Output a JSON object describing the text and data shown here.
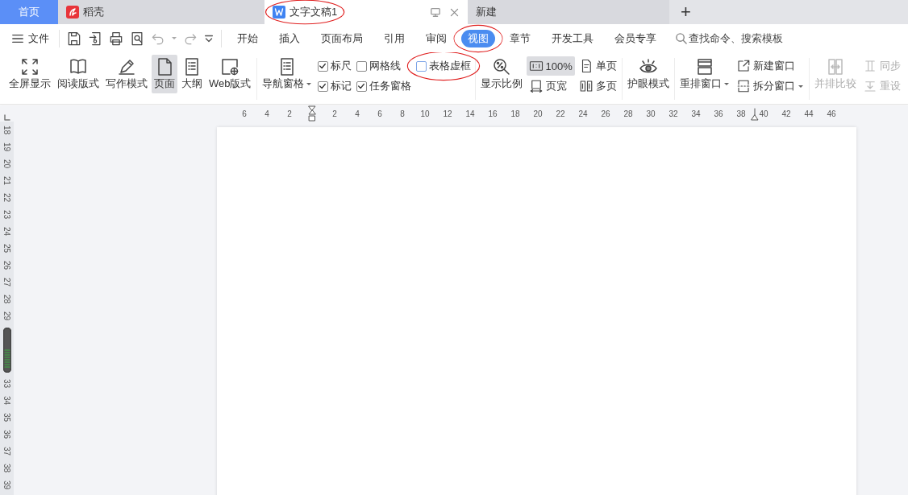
{
  "tabs": [
    {
      "kind": "home",
      "label": "首页",
      "selected": false,
      "circled": false
    },
    {
      "kind": "docer",
      "label": "稻壳",
      "selected": false,
      "circled": false
    },
    {
      "kind": "document",
      "label": "文字文稿1",
      "selected": true,
      "circled": true
    },
    {
      "kind": "new",
      "label": "新建",
      "selected": false,
      "circled": false
    }
  ],
  "new_tab_button": "+",
  "menu": {
    "file_label": "文件",
    "items": [
      {
        "label": "开始",
        "selected": false,
        "circled": false
      },
      {
        "label": "插入",
        "selected": false,
        "circled": false
      },
      {
        "label": "页面布局",
        "selected": false,
        "circled": false
      },
      {
        "label": "引用",
        "selected": false,
        "circled": false
      },
      {
        "label": "审阅",
        "selected": false,
        "circled": false
      },
      {
        "label": "视图",
        "selected": true,
        "circled": true
      },
      {
        "label": "章节",
        "selected": false,
        "circled": false
      },
      {
        "label": "开发工具",
        "selected": false,
        "circled": false
      },
      {
        "label": "会员专享",
        "selected": false,
        "circled": false
      }
    ],
    "search_placeholder": "查找命令、搜索模板"
  },
  "ribbon": {
    "groups": [
      {
        "columns": [
          {
            "kind": "large",
            "label": "全屏显示",
            "selected": false,
            "disabled": false,
            "has_menu": false
          },
          {
            "kind": "large",
            "label": "阅读版式",
            "selected": false,
            "disabled": false,
            "has_menu": false
          },
          {
            "kind": "large",
            "label": "写作模式",
            "selected": false,
            "disabled": false,
            "has_menu": false
          },
          {
            "kind": "large",
            "label": "页面",
            "selected": true,
            "disabled": false,
            "has_menu": false
          },
          {
            "kind": "large",
            "label": "大纲",
            "selected": false,
            "disabled": false,
            "has_menu": false
          },
          {
            "kind": "large",
            "label": "Web版式",
            "selected": false,
            "disabled": false,
            "has_menu": false
          }
        ]
      },
      {
        "columns": [
          {
            "kind": "large",
            "label": "导航窗格",
            "selected": false,
            "disabled": false,
            "has_menu": true
          },
          {
            "kind": "stack",
            "items": [
              {
                "kind": "check",
                "label": "标尺",
                "checked": true,
                "circled": false
              },
              {
                "kind": "check",
                "label": "标记",
                "checked": true,
                "circled": false
              }
            ]
          },
          {
            "kind": "stack",
            "items": [
              {
                "kind": "check",
                "label": "网格线",
                "checked": false,
                "circled": false
              },
              {
                "kind": "check",
                "label": "任务窗格",
                "checked": true,
                "circled": false
              }
            ]
          },
          {
            "kind": "stack",
            "items": [
              {
                "kind": "check",
                "label": "表格虚框",
                "checked": false,
                "circled": true
              }
            ]
          }
        ]
      },
      {
        "columns": [
          {
            "kind": "large",
            "label": "显示比例",
            "selected": false,
            "disabled": false,
            "has_menu": false
          },
          {
            "kind": "stack",
            "items": [
              {
                "kind": "button",
                "label": "100%",
                "selected": true,
                "disabled": false,
                "has_menu": false
              },
              {
                "kind": "button",
                "label": "页宽",
                "selected": false,
                "disabled": false,
                "has_menu": false
              }
            ]
          },
          {
            "kind": "stack",
            "items": [
              {
                "kind": "button",
                "label": "单页",
                "selected": false,
                "disabled": false,
                "has_menu": false
              },
              {
                "kind": "button",
                "label": "多页",
                "selected": false,
                "disabled": false,
                "has_menu": false
              }
            ]
          }
        ]
      },
      {
        "columns": [
          {
            "kind": "large",
            "label": "护眼模式",
            "selected": false,
            "disabled": false,
            "has_menu": false
          }
        ]
      },
      {
        "columns": [
          {
            "kind": "large",
            "label": "重排窗口",
            "selected": false,
            "disabled": false,
            "has_menu": true
          },
          {
            "kind": "stack",
            "items": [
              {
                "kind": "button",
                "label": "新建窗口",
                "selected": false,
                "disabled": false,
                "has_menu": false
              },
              {
                "kind": "button",
                "label": "拆分窗口",
                "selected": false,
                "disabled": false,
                "has_menu": true
              }
            ]
          }
        ]
      },
      {
        "columns": [
          {
            "kind": "large",
            "label": "并排比较",
            "selected": false,
            "disabled": true,
            "has_menu": false
          },
          {
            "kind": "stack",
            "items": [
              {
                "kind": "button",
                "label": "同步",
                "selected": false,
                "disabled": true,
                "has_menu": false
              },
              {
                "kind": "button",
                "label": "重设",
                "selected": false,
                "disabled": true,
                "has_menu": false
              }
            ]
          }
        ]
      }
    ]
  },
  "ruler": {
    "top": [
      {
        "kind": "number",
        "label": "6"
      },
      {
        "kind": "number",
        "label": "4"
      },
      {
        "kind": "number",
        "label": "2"
      },
      {
        "kind": "indent"
      },
      {
        "kind": "number",
        "label": "2"
      },
      {
        "kind": "number",
        "label": "4"
      },
      {
        "kind": "number",
        "label": "6"
      },
      {
        "kind": "number",
        "label": "8"
      },
      {
        "kind": "number",
        "label": "10"
      },
      {
        "kind": "number",
        "label": "12"
      },
      {
        "kind": "number",
        "label": "14"
      },
      {
        "kind": "number",
        "label": "16"
      },
      {
        "kind": "number",
        "label": "18"
      },
      {
        "kind": "number",
        "label": "20"
      },
      {
        "kind": "number",
        "label": "22"
      },
      {
        "kind": "number",
        "label": "24"
      },
      {
        "kind": "number",
        "label": "26"
      },
      {
        "kind": "number",
        "label": "28"
      },
      {
        "kind": "number",
        "label": "30"
      },
      {
        "kind": "number",
        "label": "32"
      },
      {
        "kind": "number",
        "label": "34"
      },
      {
        "kind": "number",
        "label": "36"
      },
      {
        "kind": "number",
        "label": "38"
      },
      {
        "kind": "right_indent"
      },
      {
        "kind": "number",
        "label": "40"
      },
      {
        "kind": "number",
        "label": "42"
      },
      {
        "kind": "number",
        "label": "44"
      },
      {
        "kind": "number",
        "label": "46"
      }
    ],
    "side": [
      {
        "kind": "number",
        "label": "18"
      },
      {
        "kind": "number",
        "label": "19"
      },
      {
        "kind": "number",
        "label": "20"
      },
      {
        "kind": "number",
        "label": "21"
      },
      {
        "kind": "number",
        "label": "22"
      },
      {
        "kind": "number",
        "label": "23"
      },
      {
        "kind": "number",
        "label": "24"
      },
      {
        "kind": "number",
        "label": "25"
      },
      {
        "kind": "number",
        "label": "26"
      },
      {
        "kind": "number",
        "label": "27"
      },
      {
        "kind": "number",
        "label": "28"
      },
      {
        "kind": "number",
        "label": "29"
      },
      {
        "kind": "thumb"
      },
      {
        "kind": "number",
        "label": "33"
      },
      {
        "kind": "number",
        "label": "34"
      },
      {
        "kind": "number",
        "label": "35"
      },
      {
        "kind": "number",
        "label": "36"
      },
      {
        "kind": "number",
        "label": "37"
      },
      {
        "kind": "number",
        "label": "38"
      },
      {
        "kind": "number",
        "label": "39"
      }
    ]
  }
}
